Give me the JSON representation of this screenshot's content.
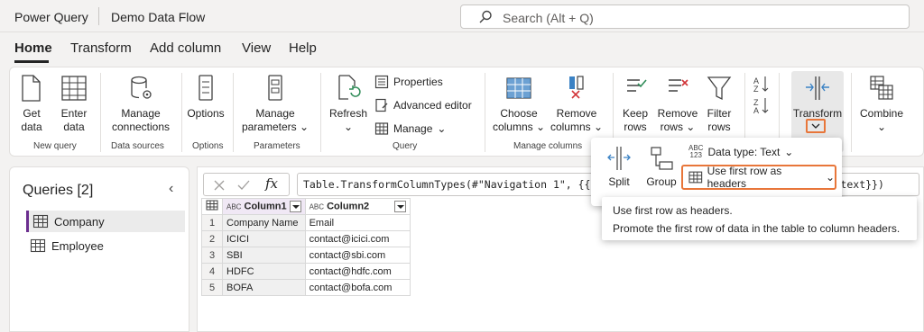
{
  "app": {
    "name": "Power Query",
    "document": "Demo Data Flow"
  },
  "search": {
    "placeholder": "Search (Alt + Q)"
  },
  "menu": {
    "tabs": [
      "Home",
      "Transform",
      "Add column",
      "View",
      "Help"
    ],
    "active": "Home"
  },
  "ribbon": {
    "get_data": "Get data",
    "enter_data": "Enter data",
    "manage_connections": "Manage connections",
    "options": "Options",
    "manage_parameters": "Manage parameters",
    "refresh": "Refresh",
    "properties": "Properties",
    "advanced_editor": "Advanced editor",
    "manage": "Manage",
    "choose_columns": "Choose columns",
    "remove_columns": "Remove columns",
    "keep_rows": "Keep rows",
    "remove_rows": "Remove rows",
    "filter_rows": "Filter rows",
    "transform": "Transform",
    "combine": "Combine",
    "groups": {
      "new_query": "New query",
      "data_sources": "Data sources",
      "options": "Options",
      "parameters": "Parameters",
      "query": "Query",
      "manage_columns": "Manage columns"
    }
  },
  "flyout": {
    "split": "Split",
    "group": "Group",
    "data_type": "Data type: Text",
    "use_first_row": "Use first row as headers",
    "tooltip_title": "Use first row as headers.",
    "tooltip_desc": "Promote the first row of data in the table to column headers."
  },
  "queries": {
    "title": "Queries [2]",
    "items": [
      {
        "label": "Company",
        "selected": true
      },
      {
        "label": "Employee",
        "selected": false
      }
    ]
  },
  "formula": {
    "text": "Table.TransformColumnTypes(#\"Navigation 1\", {{\"Column1\", type text}, {\"Column2\", type text}})"
  },
  "grid": {
    "type_icon": "ABC",
    "columns": [
      "Column1",
      "Column2"
    ],
    "rows": [
      [
        "1",
        "Company Name",
        "Email"
      ],
      [
        "2",
        "ICICI",
        "contact@icici.com"
      ],
      [
        "3",
        "SBI",
        "contact@sbi.com"
      ],
      [
        "4",
        "HDFC",
        "contact@hdfc.com"
      ],
      [
        "5",
        "BOFA",
        "contact@bofa.com"
      ]
    ]
  },
  "colors": {
    "highlight": "#e8763a",
    "accent": "#6b2e8f"
  }
}
